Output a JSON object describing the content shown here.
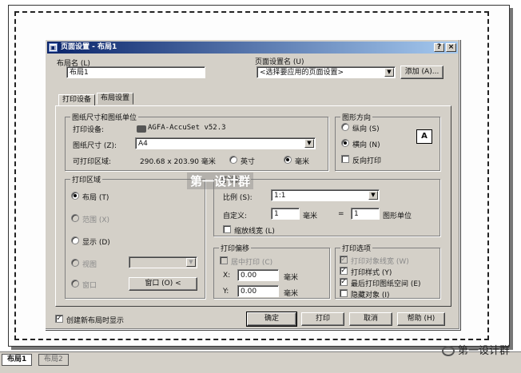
{
  "dialog": {
    "title": "页面设置 - 布局1",
    "help_btn": "?",
    "close_btn": "×"
  },
  "layout_name": {
    "label": "布局名 (L)",
    "value": "布局1"
  },
  "page_setup_name": {
    "label": "页面设置名 (U)",
    "value": "<选择要应用的页面设置>",
    "add_button": "添加 (A)..."
  },
  "tabs": [
    "打印设备",
    "布局设置"
  ],
  "paper_units": {
    "title": "图纸尺寸和图纸单位",
    "device_label": "打印设备:",
    "device_value": "AGFA-AccuSet v52.3",
    "size_label": "图纸尺寸 (Z):",
    "size_value": "A4",
    "area_label": "可打印区域:",
    "area_value": "290.68 x 203.90 毫米",
    "inch_label": "英寸",
    "mm_label": "毫米"
  },
  "orientation": {
    "title": "图形方向",
    "portrait": "纵向 (S)",
    "landscape": "横向 (N)",
    "reverse": "反向打印",
    "preview_glyph": "A"
  },
  "plot_area": {
    "title": "打印区域",
    "layout": "布局 (T)",
    "limits": "范围 (X)",
    "display": "显示 (D)",
    "view": "视图",
    "window": "窗口",
    "window_button": "窗口 (O) <"
  },
  "plot_scale": {
    "title": "打印比例",
    "scale_label": "比例 (S):",
    "scale_value": "1:1",
    "custom_label": "自定义:",
    "custom_a": "1",
    "unit_mm": "毫米",
    "equals": "=",
    "custom_b": "1",
    "drawing_units": "图形单位",
    "lineweight": "缩放线宽 (L)"
  },
  "plot_offset": {
    "title": "打印偏移",
    "center": "居中打印 (C)",
    "x_label": "X:",
    "x_value": "0.00",
    "y_label": "Y:",
    "y_value": "0.00",
    "unit": "毫米"
  },
  "plot_options": {
    "title": "打印选项",
    "lineweights": "打印对象线宽 (W)",
    "styles": "打印样式 (Y)",
    "paperspace_last": "最后打印图纸空间 (E)",
    "hide": "隐藏对象 (I)"
  },
  "footer": {
    "show_new_layout": "创建新布局时显示",
    "ok": "确定",
    "plot": "打印",
    "cancel": "取消",
    "help": "帮助 (H)"
  },
  "watermark": "第一设计群",
  "sheet_tabs": [
    "布局1",
    "布局2"
  ],
  "brand": "第一设计群"
}
